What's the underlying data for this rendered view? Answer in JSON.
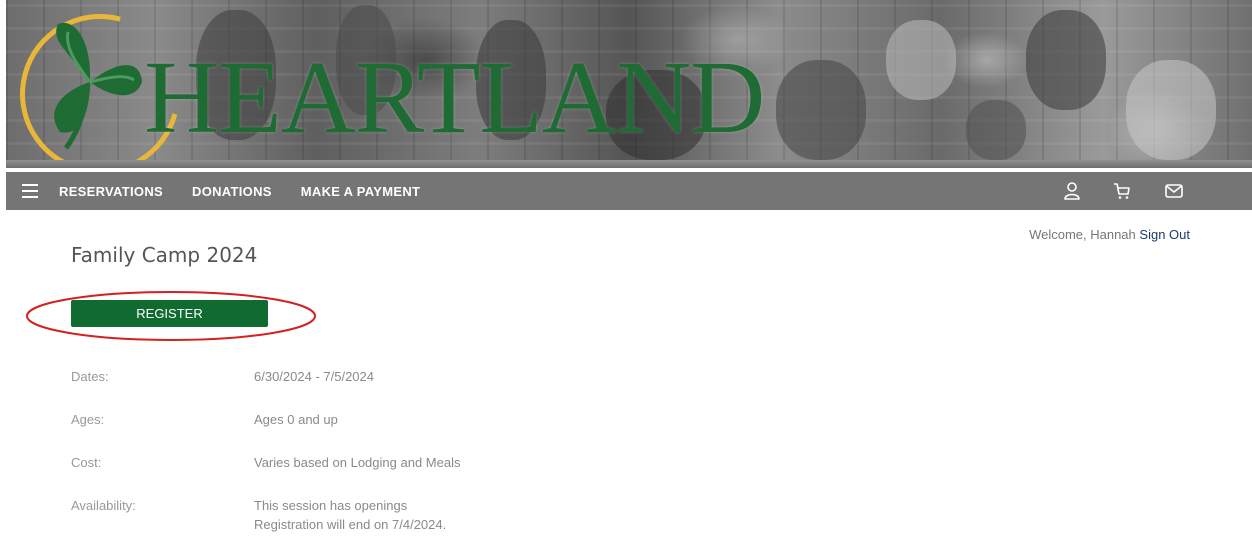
{
  "banner": {
    "logo_text": "HEARTLAND",
    "logo_ring_color": "#e8b73a",
    "logo_color": "#1e6b34"
  },
  "nav": {
    "menu_icon": "hamburger-icon",
    "links": [
      "RESERVATIONS",
      "DONATIONS",
      "MAKE A PAYMENT"
    ],
    "icons": [
      "user-icon",
      "cart-icon",
      "mail-icon"
    ],
    "background": "#757575"
  },
  "header": {
    "welcome_text": "Welcome, Hannah",
    "sign_out_label": "Sign Out"
  },
  "event": {
    "title": "Family Camp 2024",
    "register_label": "REGISTER",
    "register_color": "#0f6b30",
    "annotation_color": "#d42020",
    "details": {
      "dates_label": "Dates:",
      "dates_value": "6/30/2024 - 7/5/2024",
      "ages_label": "Ages:",
      "ages_value": "Ages 0 and up",
      "cost_label": "Cost:",
      "cost_value": "Varies based on Lodging and Meals",
      "availability_label": "Availability:",
      "availability_line1": "This session has openings",
      "availability_line2": "Registration will end on 7/4/2024."
    }
  }
}
